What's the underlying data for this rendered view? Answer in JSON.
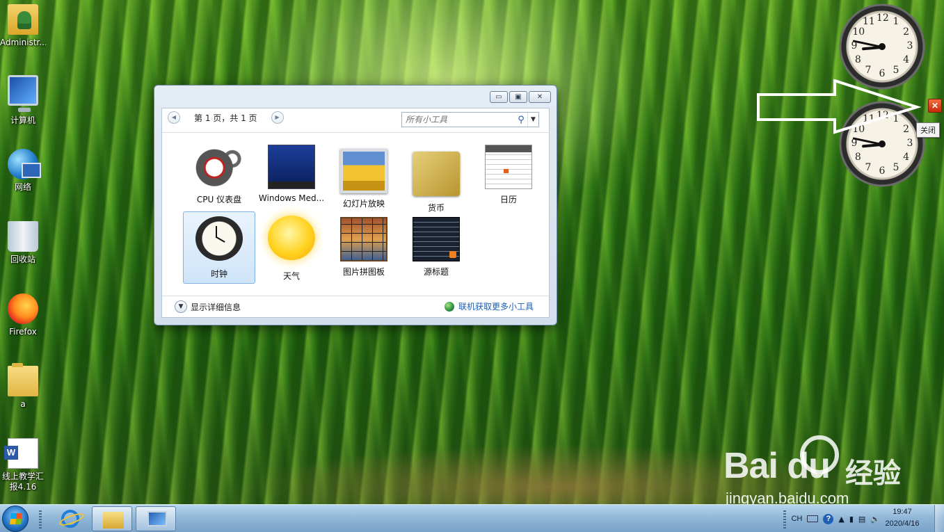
{
  "desktop": {
    "icons": [
      {
        "label": "Administr..."
      },
      {
        "label": "计算机"
      },
      {
        "label": "网络"
      },
      {
        "label": "回收站"
      },
      {
        "label": "Firefox"
      },
      {
        "label": "a"
      },
      {
        "label": "线上教学汇报4.16"
      }
    ]
  },
  "gadget_window": {
    "controls": {
      "minimize": "▭",
      "restore": "▣",
      "close": "✕"
    },
    "pagination": {
      "prev": "◀",
      "text": "第 1 页，共 1 页",
      "next": "▶"
    },
    "search": {
      "placeholder": "所有小工具"
    },
    "gadgets": [
      {
        "name": "CPU 仪表盘",
        "selected": false
      },
      {
        "name": "Windows Med...",
        "selected": false
      },
      {
        "name": "幻灯片放映",
        "selected": false
      },
      {
        "name": "货币",
        "selected": false
      },
      {
        "name": "日历",
        "selected": false
      },
      {
        "name": "时钟",
        "selected": true
      },
      {
        "name": "天气",
        "selected": false
      },
      {
        "name": "图片拼图板",
        "selected": false
      },
      {
        "name": "源标题",
        "selected": false
      }
    ],
    "details_label": "显示详细信息",
    "online_label": "联机获取更多小工具"
  },
  "clock_numbers": [
    "12",
    "1",
    "2",
    "3",
    "4",
    "5",
    "6",
    "7",
    "8",
    "9",
    "10",
    "11"
  ],
  "close_tooltip": "关闭",
  "watermark": {
    "logo": "Bai du",
    "text": "经验",
    "url": "jingyan.baidu.com"
  },
  "taskbar": {
    "tray": {
      "lang": "CH",
      "help": "?"
    },
    "time": "19:47",
    "date": "2020/4/16"
  },
  "colors": {
    "accent": "#1a5fb4",
    "selection": "#cfe4f9",
    "close_red": "#c72a08"
  }
}
